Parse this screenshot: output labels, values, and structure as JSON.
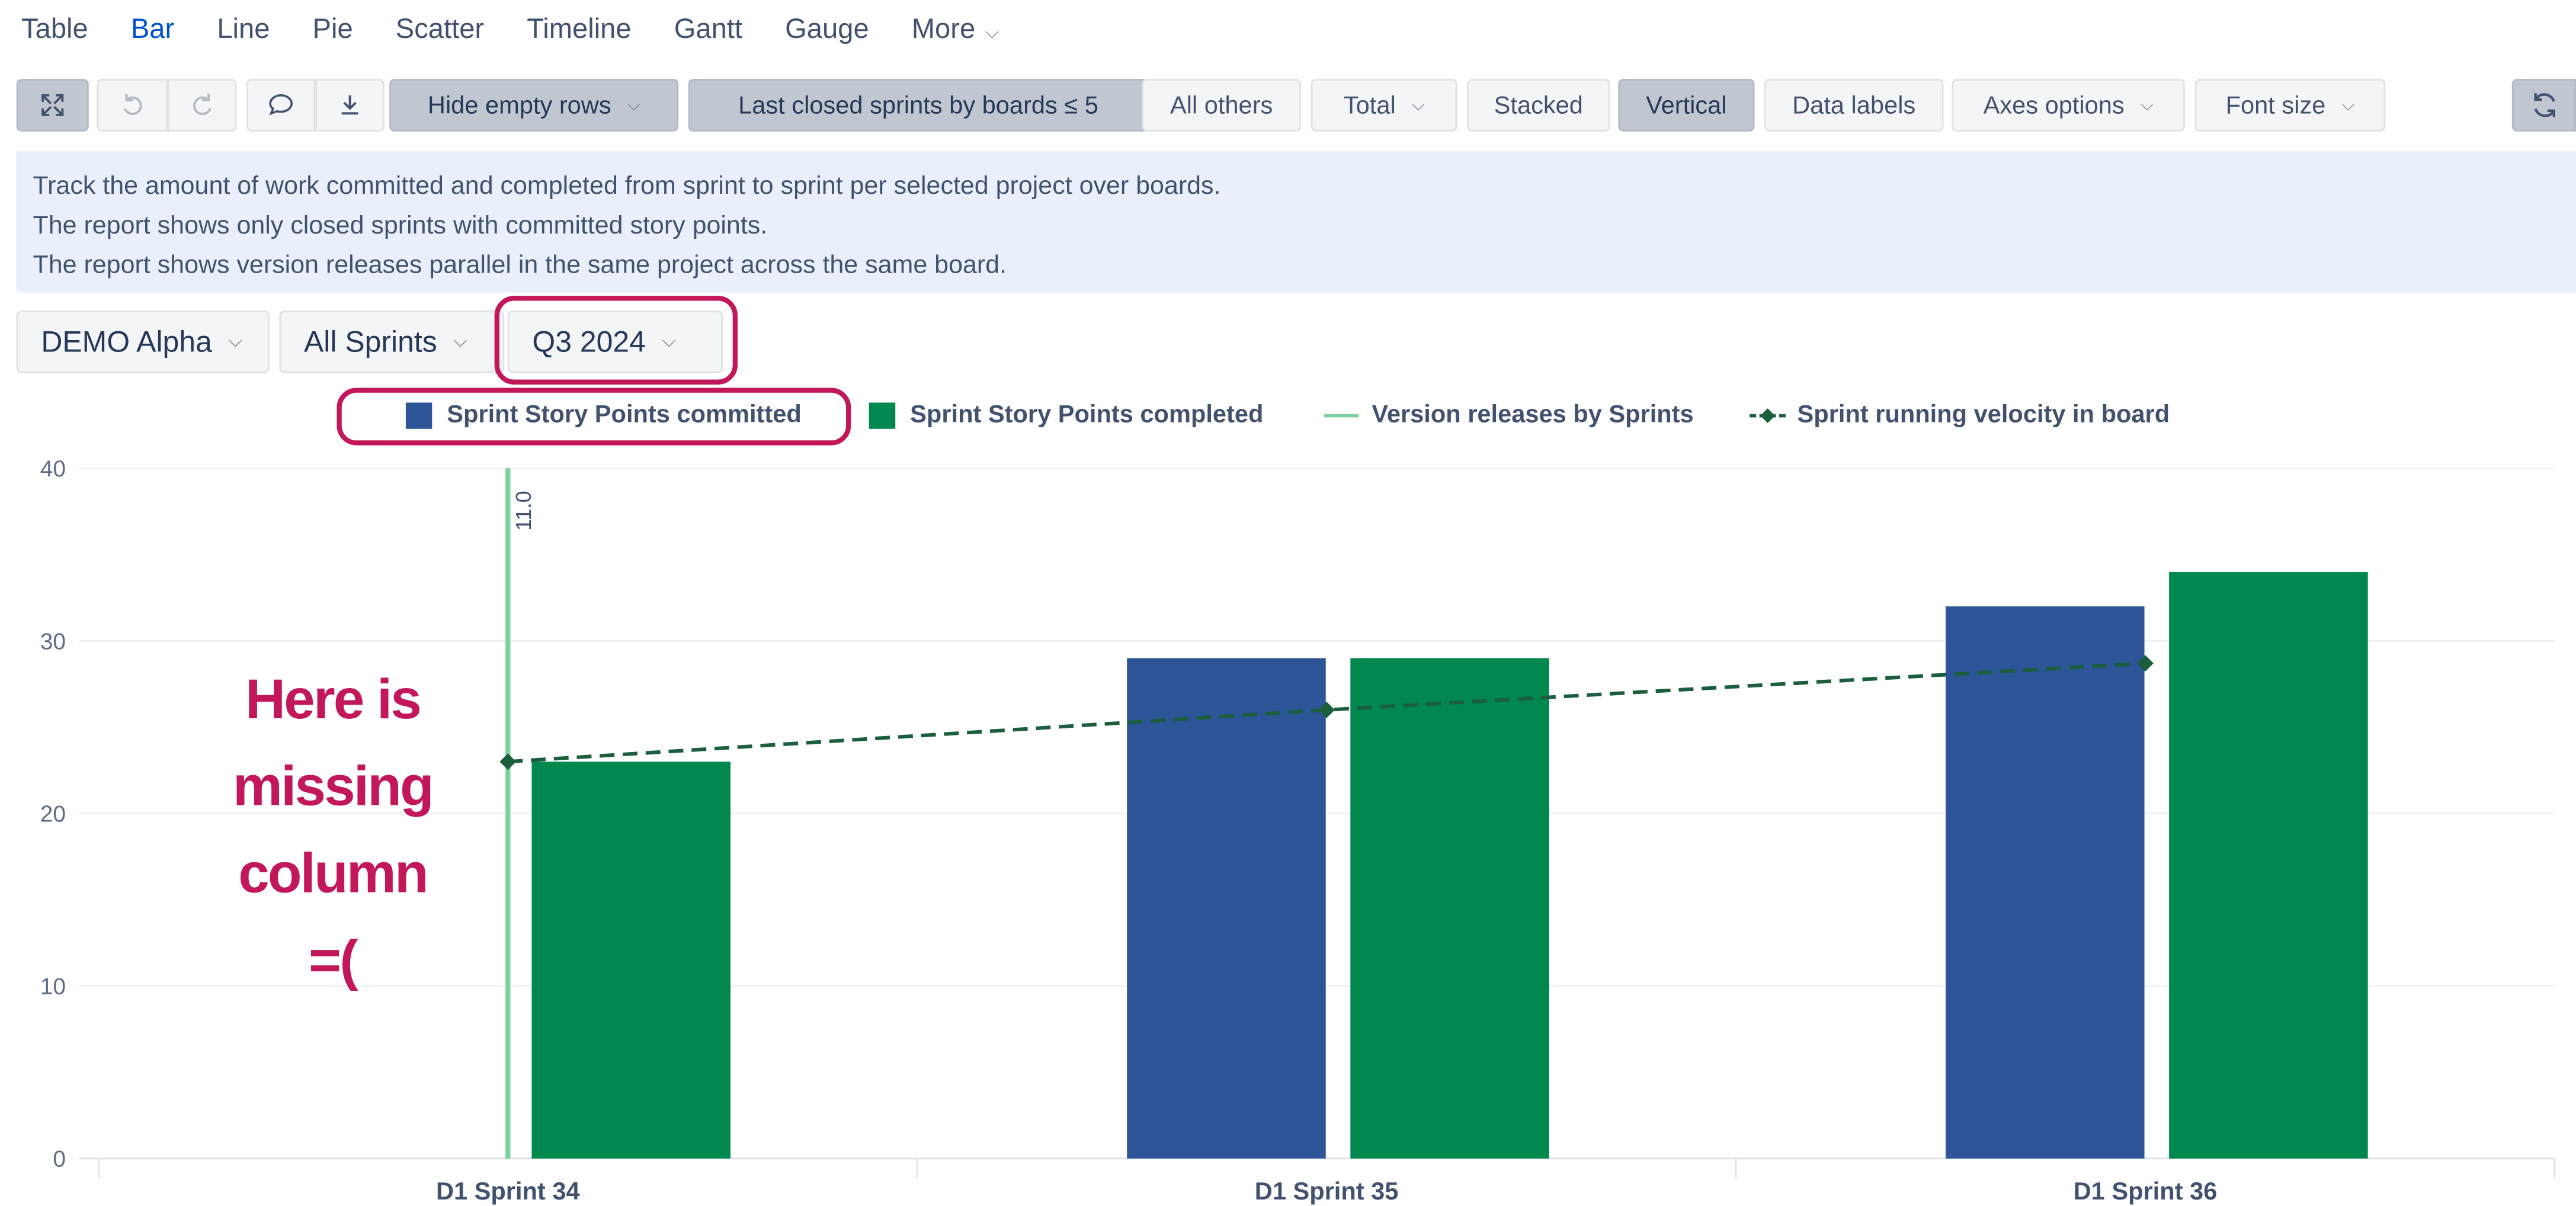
{
  "tabs": [
    {
      "label": "Table",
      "active": false
    },
    {
      "label": "Bar",
      "active": true
    },
    {
      "label": "Line",
      "active": false
    },
    {
      "label": "Pie",
      "active": false
    },
    {
      "label": "Scatter",
      "active": false
    },
    {
      "label": "Timeline",
      "active": false
    },
    {
      "label": "Gantt",
      "active": false
    },
    {
      "label": "Gauge",
      "active": false
    },
    {
      "label": "More",
      "active": false
    }
  ],
  "toolbar": {
    "fullscreen_icon": "fullscreen-icon",
    "undo_icon": "undo-icon",
    "redo_icon": "redo-icon",
    "comment_icon": "comment-icon",
    "download_icon": "download-icon",
    "hide_empty_rows": "Hide empty rows",
    "last_closed_sprints": "Last closed sprints by boards ≤ 5",
    "all_others": "All others",
    "total": "Total",
    "stacked": "Stacked",
    "vertical": "Vertical",
    "data_labels": "Data labels",
    "axes_options": "Axes options",
    "font_size": "Font size",
    "refresh_icon": "refresh-icon"
  },
  "info": {
    "line1": "Track the amount of work committed and completed from sprint to sprint per selected project over boards.",
    "line2": "The report shows only closed sprints with committed story points.",
    "line3": "The report shows version releases parallel in the same project across the same board."
  },
  "selectors": {
    "project": "DEMO Alpha",
    "sprints": "All Sprints",
    "period": "Q3 2024"
  },
  "annotation": {
    "line1": "Here is",
    "line2": "missing",
    "line3": "column",
    "line4": "=("
  },
  "colors": {
    "committed": "#2e5597",
    "completed": "#00884e",
    "release": "#79d19b",
    "velocity": "#1a5e3c",
    "annotation": "#c2185b"
  },
  "chart_data": {
    "type": "bar",
    "categories": [
      "D1 Sprint 34",
      "D1 Sprint 35",
      "D1 Sprint 36"
    ],
    "ylim": [
      0,
      40
    ],
    "yticks": [
      0,
      10,
      20,
      30,
      40
    ],
    "series": [
      {
        "name": "Sprint Story Points committed",
        "type": "bar",
        "values": [
          null,
          29,
          32
        ]
      },
      {
        "name": "Sprint Story Points completed",
        "type": "bar",
        "values": [
          23,
          29,
          34
        ]
      },
      {
        "name": "Version releases by Sprints",
        "type": "vertical-line",
        "category": "D1 Sprint 34",
        "label": "11.0"
      },
      {
        "name": "Sprint running velocity in board",
        "type": "line",
        "dashed": true,
        "values": [
          23,
          26,
          28.7
        ]
      }
    ],
    "legend_position": "top"
  }
}
